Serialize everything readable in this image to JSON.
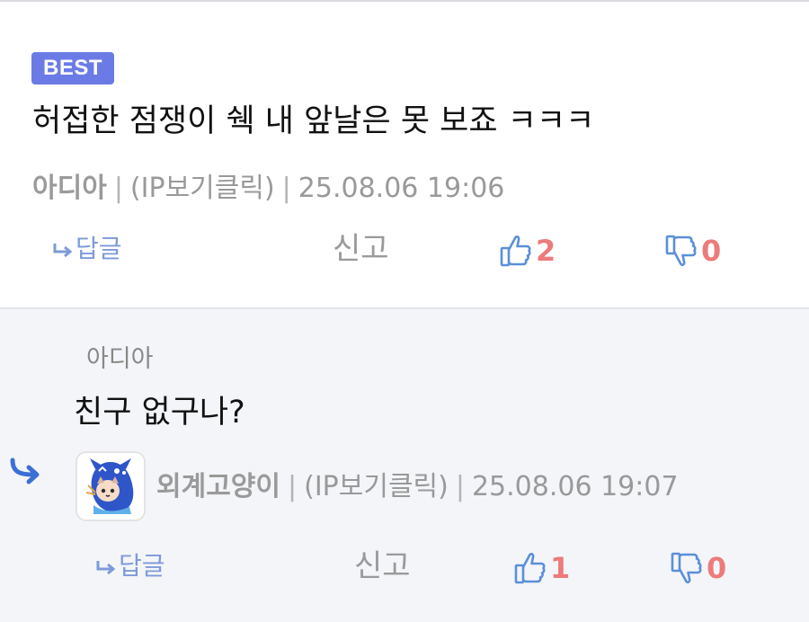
{
  "main_comment": {
    "badge": "BEST",
    "text": "허접한 점쟁이 쉑 내 앞날은 못 보죠 ㅋㅋㅋ",
    "author": "아디아",
    "separator": "|",
    "ip": "(IP보기클릭)",
    "timestamp": "25.08.06 19:06",
    "reply_label": "답글",
    "report_label": "신고",
    "upvotes": "2",
    "downvotes": "0"
  },
  "reply_comment": {
    "reply_to": "아디아",
    "text": "친구 없구나?",
    "author": "외계고양이",
    "separator": "|",
    "ip": "(IP보기클릭)",
    "timestamp": "25.08.06 19:07",
    "reply_label": "답글",
    "report_label": "신고",
    "upvotes": "1",
    "downvotes": "0"
  },
  "colors": {
    "badge_bg": "#6b7be6",
    "link_blue": "#7d9ad9",
    "vote_count": "#ec7b7b",
    "muted_text": "#999999",
    "reply_bg": "#f4f5f8"
  },
  "icons": {
    "reply_arrow": "reply-arrow-icon",
    "thumbs_up": "thumbs-up-icon",
    "thumbs_down": "thumbs-down-icon",
    "reply_indicator": "reply-indicator-arrow-icon"
  }
}
